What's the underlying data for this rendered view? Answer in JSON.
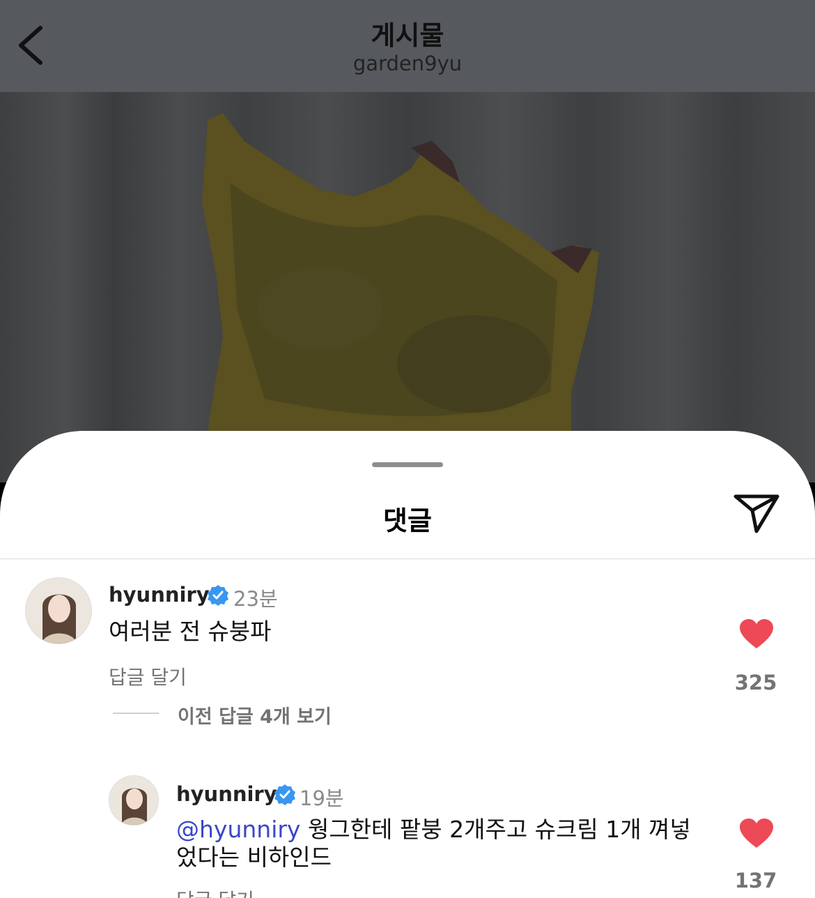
{
  "header": {
    "title": "게시물",
    "subtitle": "garden9yu"
  },
  "sheet": {
    "title": "댓글"
  },
  "comments": [
    {
      "username": "hyunniry",
      "time": "23분",
      "text": "여러분 전 슈붕파",
      "reply_label": "답글 달기",
      "likes": "325",
      "view_replies": "이전 답글 4개 보기"
    },
    {
      "username": "hyunniry",
      "time": "19분",
      "mention": "@hyunniry",
      "text_line1": " 웡그한테 팥붕 2개주고 슈크림 1개 껴넣",
      "text_line2": "었다는 비하인드",
      "reply_label": "답글 달기",
      "likes": "137"
    }
  ],
  "icons": {
    "back": "chevron-left-icon",
    "share": "send-icon",
    "like": "heart-icon",
    "verified": "verified-badge-icon"
  },
  "colors": {
    "like": "#ed4956",
    "verified": "#3897f0",
    "mention": "#3a46c8"
  }
}
